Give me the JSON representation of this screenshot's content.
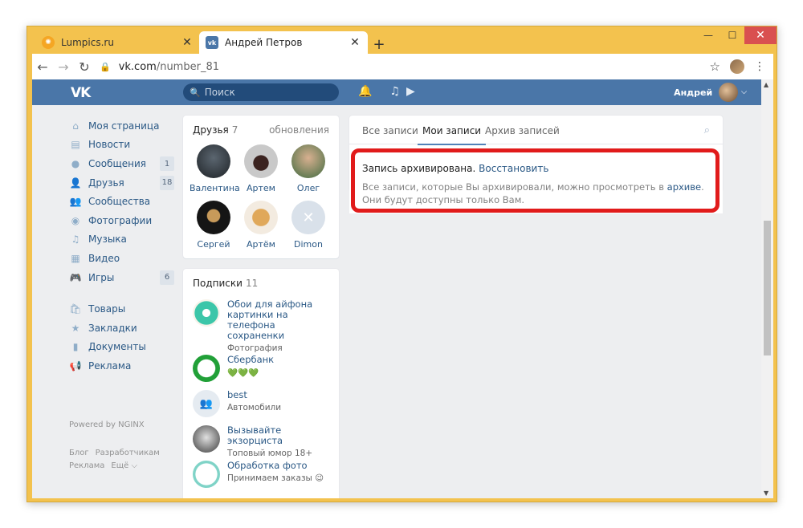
{
  "browser": {
    "tabs": [
      {
        "title": "Lumpics.ru",
        "active": false
      },
      {
        "title": "Андрей Петров",
        "active": true
      }
    ],
    "new_tab": "+",
    "url_host": "vk.com",
    "url_path": "/number_81",
    "window_controls": {
      "minimize": "—",
      "maximize": "☐",
      "close": "✕"
    }
  },
  "vk": {
    "search_placeholder": "Поиск",
    "user_name": "Андрей",
    "nav": [
      {
        "label": "Моя страница",
        "icon": "home-icon"
      },
      {
        "label": "Новости",
        "icon": "news-icon"
      },
      {
        "label": "Сообщения",
        "icon": "messages-icon",
        "badge": "1"
      },
      {
        "label": "Друзья",
        "icon": "friends-icon",
        "badge": "18"
      },
      {
        "label": "Сообщества",
        "icon": "groups-icon"
      },
      {
        "label": "Фотографии",
        "icon": "photos-icon"
      },
      {
        "label": "Музыка",
        "icon": "music-icon"
      },
      {
        "label": "Видео",
        "icon": "video-icon"
      },
      {
        "label": "Игры",
        "icon": "games-icon",
        "badge": "6"
      },
      {
        "label": "Товары",
        "icon": "market-icon"
      },
      {
        "label": "Закладки",
        "icon": "bookmarks-icon"
      },
      {
        "label": "Документы",
        "icon": "documents-icon"
      },
      {
        "label": "Реклама",
        "icon": "ads-icon"
      }
    ],
    "powered": "Powered by NGINX",
    "footer_links": [
      "Блог",
      "Разработчикам",
      "Реклама",
      "Ещё ⌵"
    ],
    "friends": {
      "title": "Друзья",
      "count": "7",
      "updates": "обновления",
      "items": [
        "Валентина",
        "Артем",
        "Олег",
        "Сергей",
        "Артём",
        "Dimon"
      ]
    },
    "subscriptions": {
      "title": "Подписки",
      "count": "11",
      "items": [
        {
          "title": "Обои для айфона картинки на телефона сохраненки",
          "desc": "Фотография"
        },
        {
          "title": "Сбербанк",
          "desc": "💚💚💚"
        },
        {
          "title": "best",
          "desc": "Автомобили"
        },
        {
          "title": "Вызывайте экзорциста",
          "desc": "Топовый юмор 18+"
        },
        {
          "title": "Обработка фото",
          "desc": "Принимаем заказы 😉"
        }
      ]
    },
    "feed": {
      "tabs": [
        "Все записи",
        "Мои записи",
        "Архив записей"
      ],
      "selected_tab": "Мои записи",
      "notice_title": "Запись архивирована.",
      "restore_link": "Восстановить",
      "notice_text_before": "Все записи, которые Вы архивировали, можно просмотреть в",
      "archive_link": "архиве",
      "notice_text_after": ".",
      "notice_text_line2": "Они будут доступны только Вам."
    },
    "colors": {
      "header": "#4a76a8",
      "link": "#2a5885",
      "highlight": "#e11b1b"
    }
  }
}
